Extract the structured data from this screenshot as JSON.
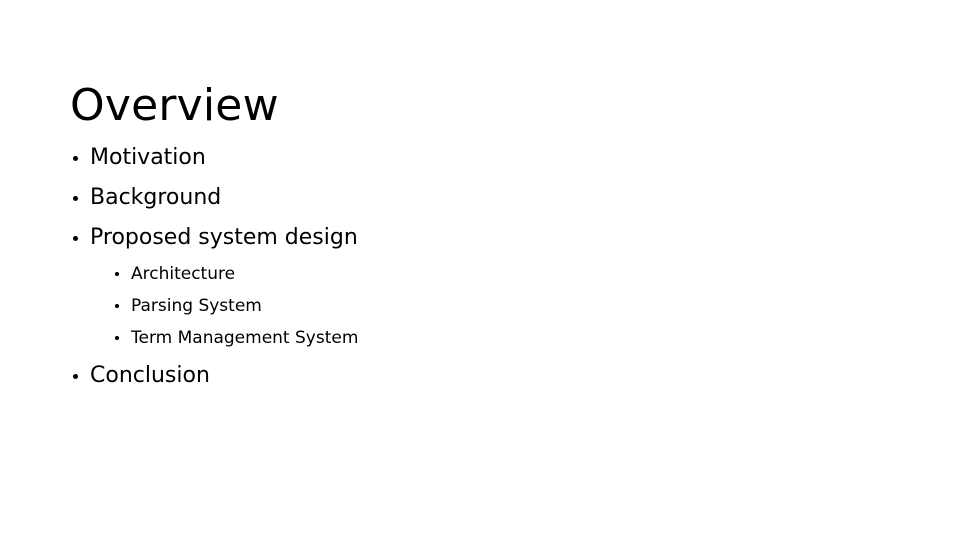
{
  "slide": {
    "title": "Overview",
    "background_color": "#ffffff",
    "text_color": "#000000",
    "outline": [
      {
        "level": 1,
        "label": "Motivation",
        "bullet_glyph": "•"
      },
      {
        "level": 1,
        "label": "Background",
        "bullet_glyph": "•"
      },
      {
        "level": 1,
        "label": "Proposed system design",
        "bullet_glyph": "•",
        "children": [
          {
            "level": 2,
            "label": "Architecture",
            "bullet_glyph": "•"
          },
          {
            "level": 2,
            "label": "Parsing System",
            "bullet_glyph": "•"
          },
          {
            "level": 2,
            "label": "Term Management System",
            "bullet_glyph": "•"
          }
        ]
      },
      {
        "level": 1,
        "label": "Conclusion",
        "bullet_glyph": "•"
      }
    ]
  }
}
